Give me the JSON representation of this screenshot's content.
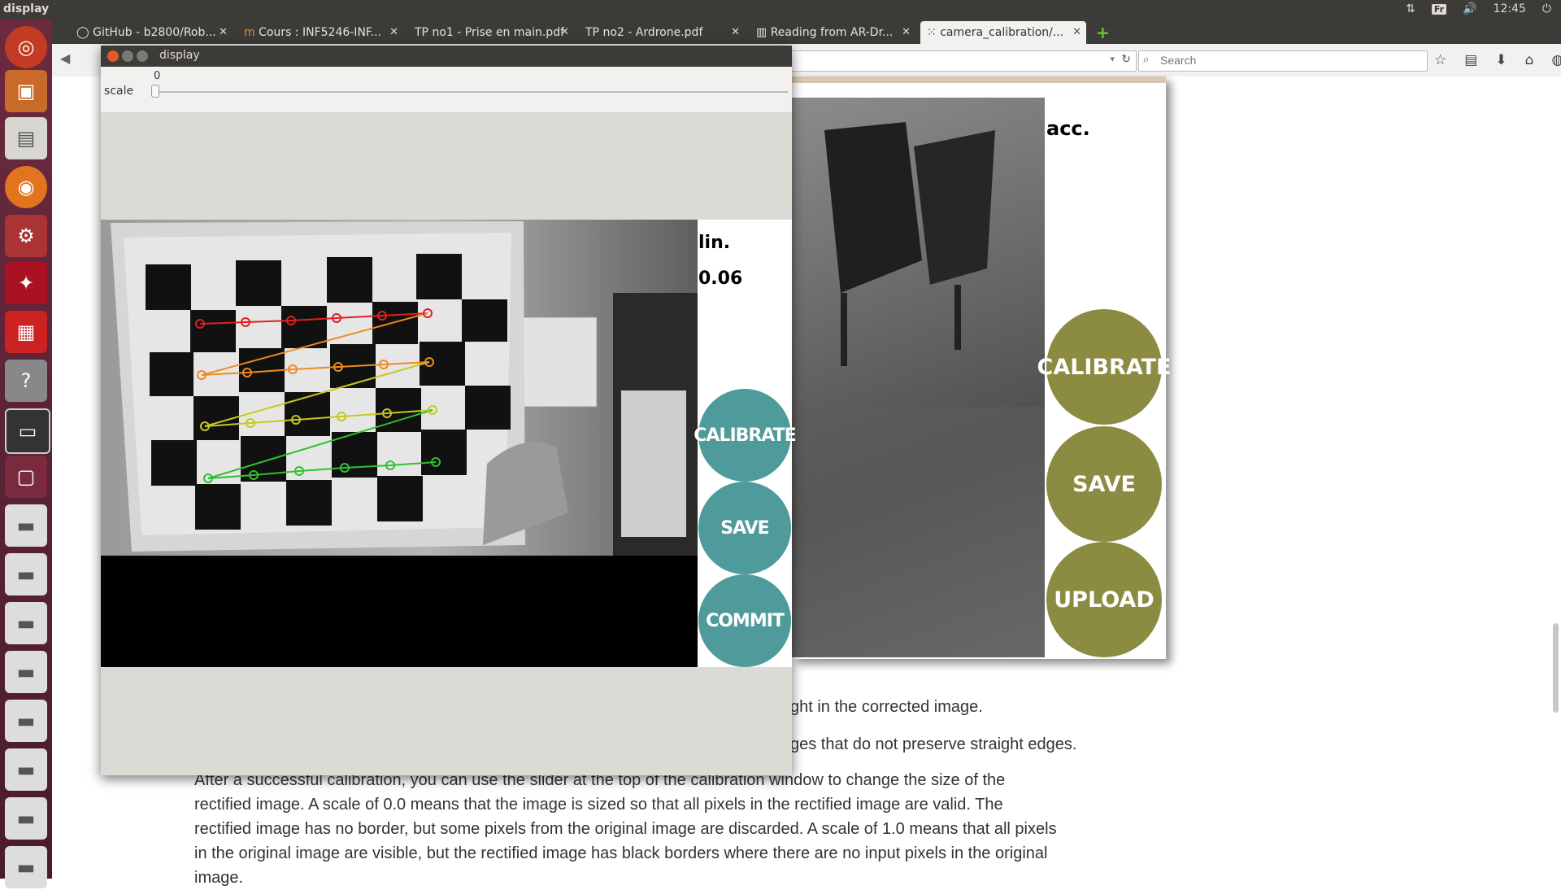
{
  "topbar": {
    "title": "display",
    "keyboard": "Fr",
    "time": "12:45"
  },
  "browser": {
    "tabs": [
      {
        "label": "GitHub - b2800/Rob..."
      },
      {
        "label": "Cours : INF5246-INF..."
      },
      {
        "label": "TP no1 - Prise en main.pdf"
      },
      {
        "label": "TP no2 - Ardrone.pdf"
      },
      {
        "label": "Reading from AR-Dr..."
      },
      {
        "label": "camera_calibration/..."
      }
    ],
    "search_placeholder": "Search"
  },
  "page": {
    "bg_label": "acc.",
    "bg_buttons": {
      "calibrate": "CALIBRATE",
      "save": "SAVE",
      "upload": "UPLOAD"
    },
    "line1": "ght in the corrected image.",
    "line2": "ges that do not preserve straight edges.",
    "paragraph": [
      "After a successful calibration, you can use the slider at the top of the calibration window to change the size of the",
      "rectified image. A scale of 0.0 means that the image is sized so that all pixels in the rectified image are valid. The",
      "rectified image has no border, but some pixels from the original image are discarded. A scale of 1.0 means that all pixels",
      "in the original image are visible, but the rectified image has black borders where there are no input pixels in the original",
      "image."
    ]
  },
  "window": {
    "title": "display",
    "slider": {
      "label": "scale",
      "value": "0"
    },
    "side": {
      "label": "lin.",
      "value": "0.06"
    },
    "buttons": {
      "calibrate": "CALIBRATE",
      "save": "SAVE",
      "commit": "COMMIT"
    }
  },
  "colors": {
    "teal": "#4f9a9a",
    "olive": "#8b8b42",
    "panel_dark": "#3c3b37"
  }
}
